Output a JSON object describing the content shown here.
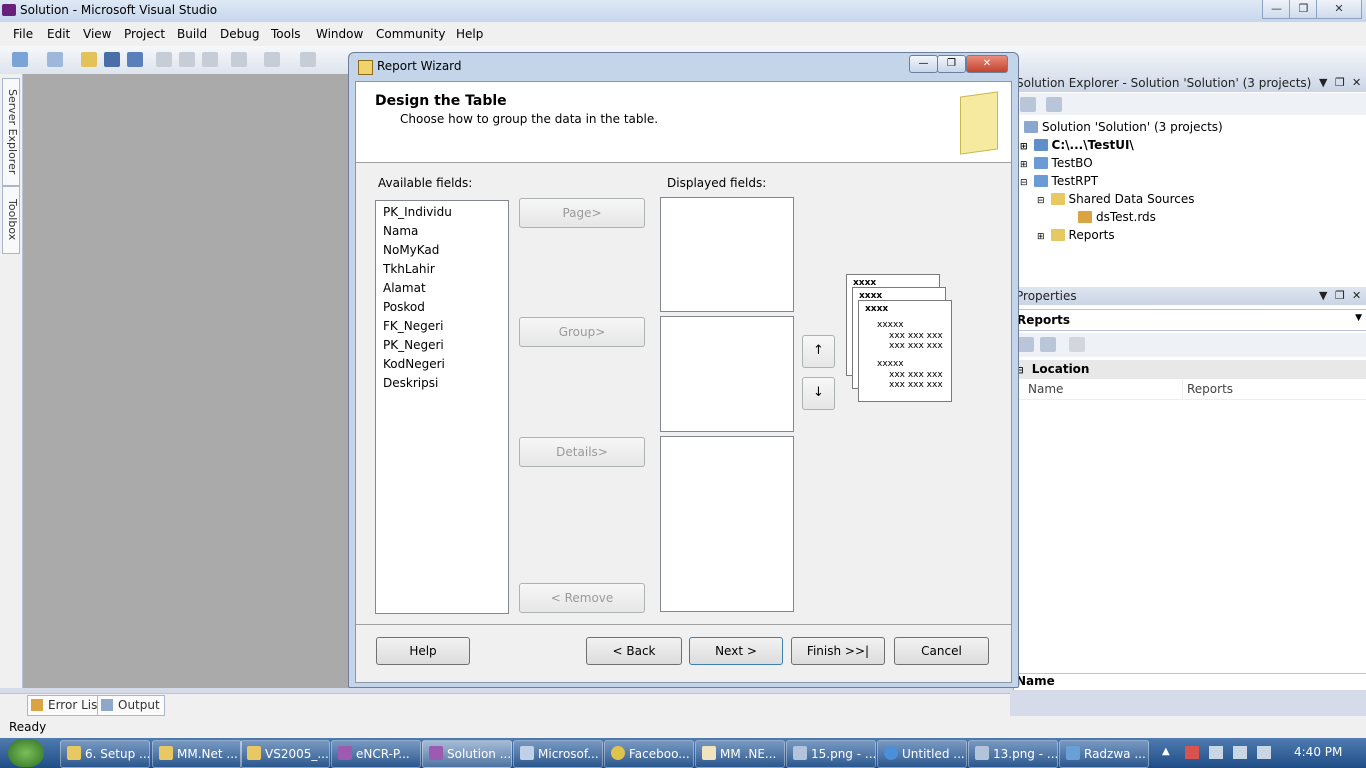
{
  "window": {
    "title": "Solution - Microsoft Visual Studio",
    "min": "—",
    "max": "❐",
    "close": "✕"
  },
  "menu": [
    "File",
    "Edit",
    "View",
    "Project",
    "Build",
    "Debug",
    "Tools",
    "Window",
    "Community",
    "Help"
  ],
  "sidetabs": {
    "server_explorer": "Server Explorer",
    "toolbox": "Toolbox"
  },
  "bottom_tabs": {
    "error_list": "Error List",
    "output": "Output"
  },
  "status": {
    "text": "Ready"
  },
  "solution_explorer": {
    "title": "Solution Explorer - Solution 'Solution' (3 projects)",
    "pin": "❒",
    "close": "✕",
    "tree": [
      {
        "label": "Solution 'Solution' (3 projects)"
      },
      {
        "label": "C:\\...\\TestUI\\"
      },
      {
        "label": "TestBO"
      },
      {
        "label": "TestRPT"
      },
      {
        "label": "Shared Data Sources"
      },
      {
        "label": "dsTest.rds"
      },
      {
        "label": "Reports"
      }
    ]
  },
  "properties": {
    "title": "Properties",
    "object": "Reports",
    "category": "Location",
    "rows": [
      {
        "name": "Name",
        "value": "Reports"
      }
    ],
    "footer": "Name"
  },
  "dialog": {
    "title": "Report Wizard",
    "heading": "Design the Table",
    "subheading": "Choose how to group the data in the table.",
    "available_label": "Available fields:",
    "displayed_label": "Displayed fields:",
    "available_fields": [
      "PK_Individu",
      "Nama",
      "NoMyKad",
      "TkhLahir",
      "Alamat",
      "Poskod",
      "FK_Negeri",
      "PK_Negeri",
      "KodNegeri",
      "Deskripsi"
    ],
    "buttons": {
      "page": "Page>",
      "group": "Group>",
      "details": "Details>",
      "remove": "< Remove",
      "help": "Help",
      "back": "< Back",
      "next": "Next >",
      "finish": "Finish >>|",
      "cancel": "Cancel",
      "up": "↑",
      "down": "↓"
    },
    "preview": {
      "header": "xxxx",
      "group": "xxxxx",
      "row": "xxx xxx xxx"
    }
  },
  "taskbar": {
    "items": [
      "6. Setup ...",
      "MM.Net ...",
      "VS2005_...",
      "eNCR-P...",
      "Solution ...",
      "Microsof...",
      "Faceboo...",
      "MM .NE...",
      "15.png - ...",
      "Untitled ...",
      "13.png - ...",
      "Radzwa ..."
    ],
    "clock": "4:40 PM",
    "tray_arrow": "▲"
  }
}
